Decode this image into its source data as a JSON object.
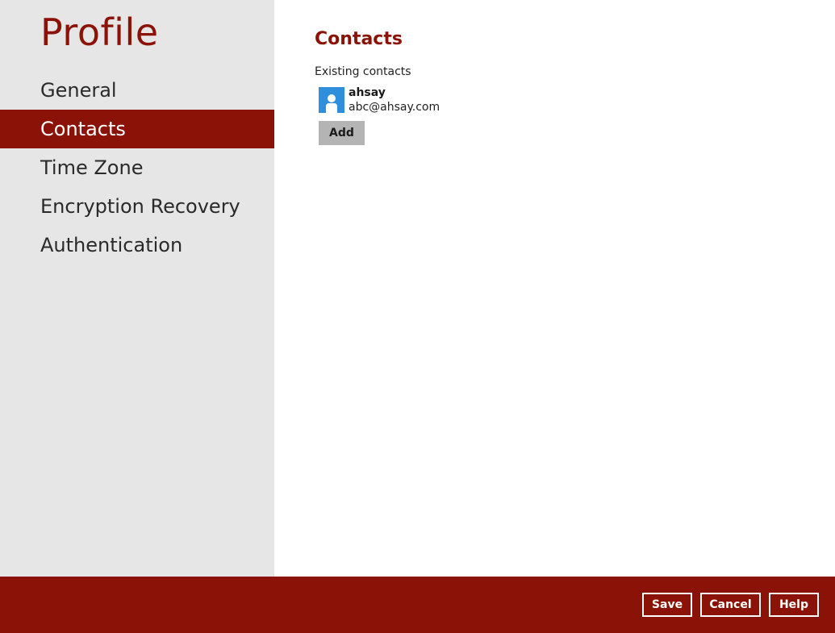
{
  "sidebar": {
    "title": "Profile",
    "items": [
      {
        "label": "General",
        "active": false
      },
      {
        "label": "Contacts",
        "active": true
      },
      {
        "label": "Time Zone",
        "active": false
      },
      {
        "label": "Encryption Recovery",
        "active": false
      },
      {
        "label": "Authentication",
        "active": false
      }
    ]
  },
  "main": {
    "title": "Contacts",
    "existing_label": "Existing contacts",
    "contacts": [
      {
        "name": "ahsay",
        "email": "abc@ahsay.com",
        "icon": "user-avatar-icon"
      }
    ],
    "add_label": "Add"
  },
  "footer": {
    "save_label": "Save",
    "cancel_label": "Cancel",
    "help_label": "Help"
  },
  "colors": {
    "accent": "#8b1206",
    "sidebar_bg": "#e6e6e6",
    "avatar_bg": "#2f8fdc",
    "add_button_bg": "#b4b4b4"
  }
}
